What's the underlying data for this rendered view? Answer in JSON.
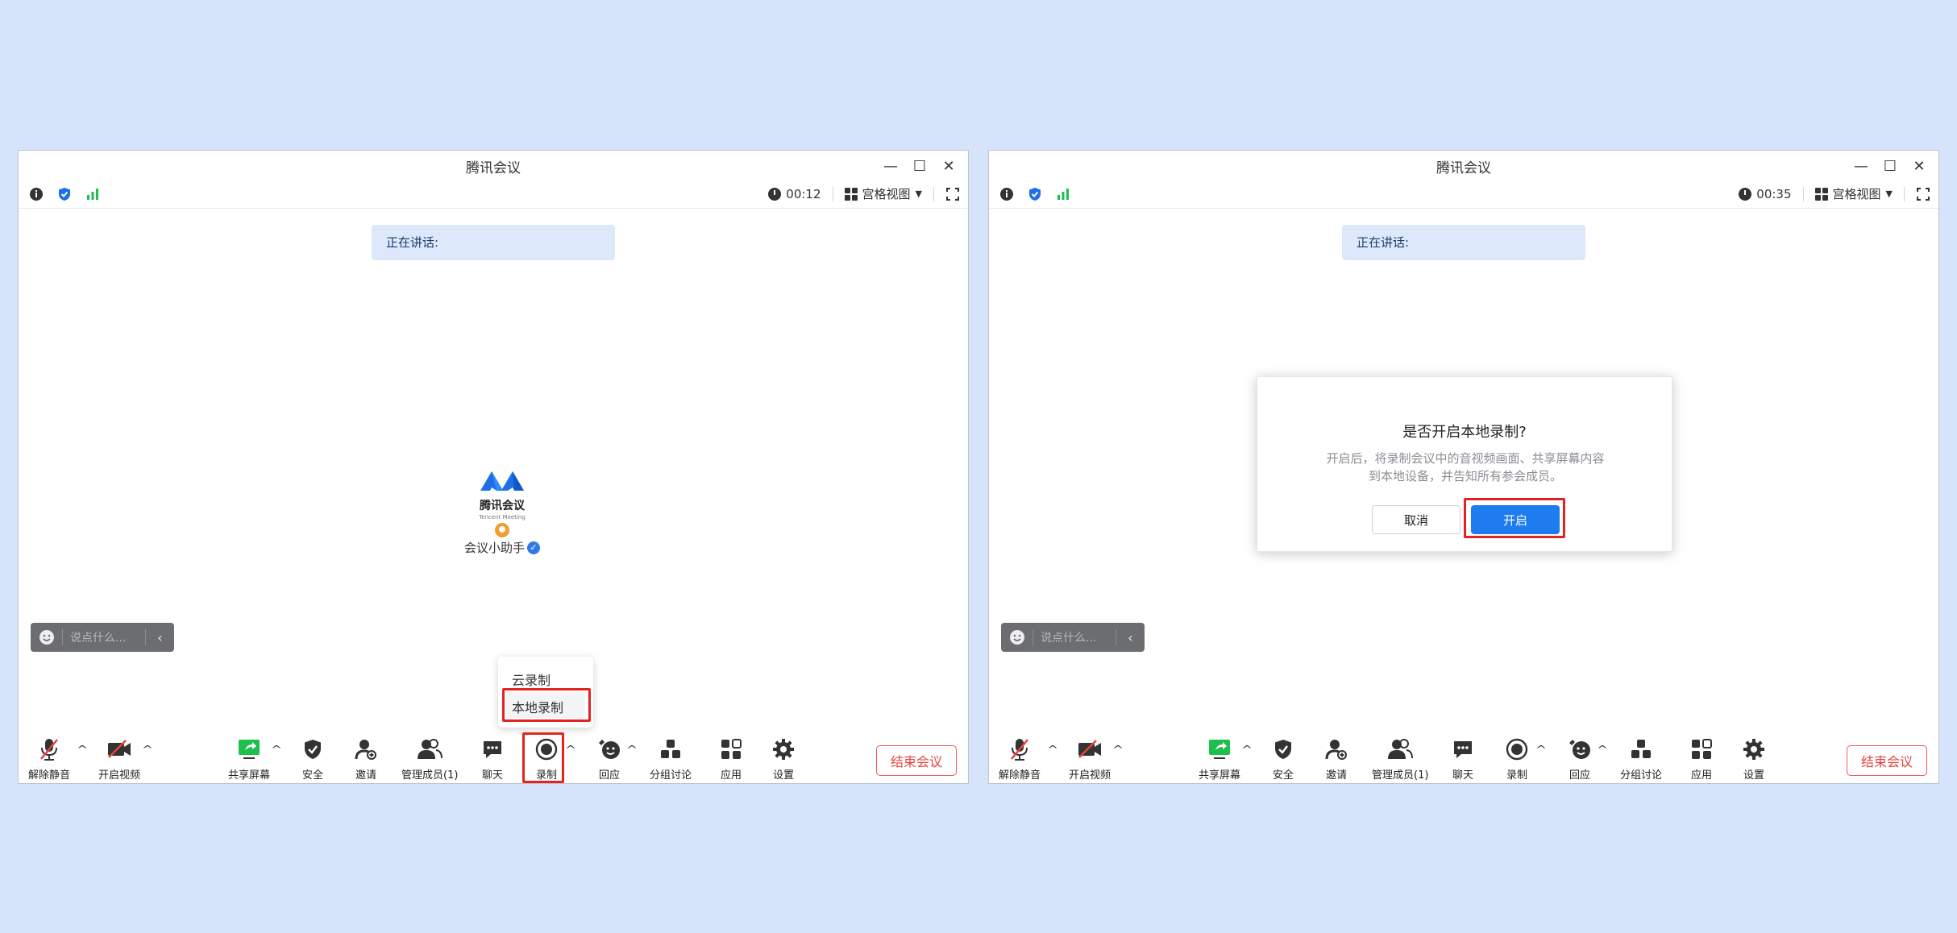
{
  "colors": {
    "background": "#d6e4fb",
    "accent": "#1e7bf0",
    "danger": "#e8423e",
    "highlight": "#e5231e",
    "signal": "#1fbf4d",
    "share_green": "#1fbf4d"
  },
  "windows": [
    {
      "title": "腾讯会议",
      "timer": "00:12",
      "view_label": "宫格视图",
      "speaking_label": "正在讲话:",
      "brand_name": "腾讯会议",
      "brand_sub": "Tencent Meeting",
      "assistant_name": "会议小助手",
      "chat_placeholder": "说点什么...",
      "toolbar": {
        "mute": "解除静音",
        "video": "开启视频",
        "share": "共享屏幕",
        "security": "安全",
        "invite": "邀请",
        "members": "管理成员(1)",
        "chat": "聊天",
        "record": "录制",
        "react": "回应",
        "breakout": "分组讨论",
        "apps": "应用",
        "settings": "设置",
        "end": "结束会议"
      },
      "record_menu": {
        "items": [
          "云录制",
          "本地录制"
        ],
        "highlighted": "本地录制"
      }
    },
    {
      "title": "腾讯会议",
      "timer": "00:35",
      "view_label": "宫格视图",
      "speaking_label": "正在讲话:",
      "chat_placeholder": "说点什么...",
      "toolbar": {
        "mute": "解除静音",
        "video": "开启视频",
        "share": "共享屏幕",
        "security": "安全",
        "invite": "邀请",
        "members": "管理成员(1)",
        "chat": "聊天",
        "record": "录制",
        "react": "回应",
        "breakout": "分组讨论",
        "apps": "应用",
        "settings": "设置",
        "end": "结束会议"
      },
      "dialog": {
        "title": "是否开启本地录制?",
        "message_line1": "开启后，将录制会议中的音视频画面、共享屏幕内容",
        "message_line2": "到本地设备，并告知所有参会成员。",
        "cancel": "取消",
        "confirm": "开启"
      }
    }
  ]
}
